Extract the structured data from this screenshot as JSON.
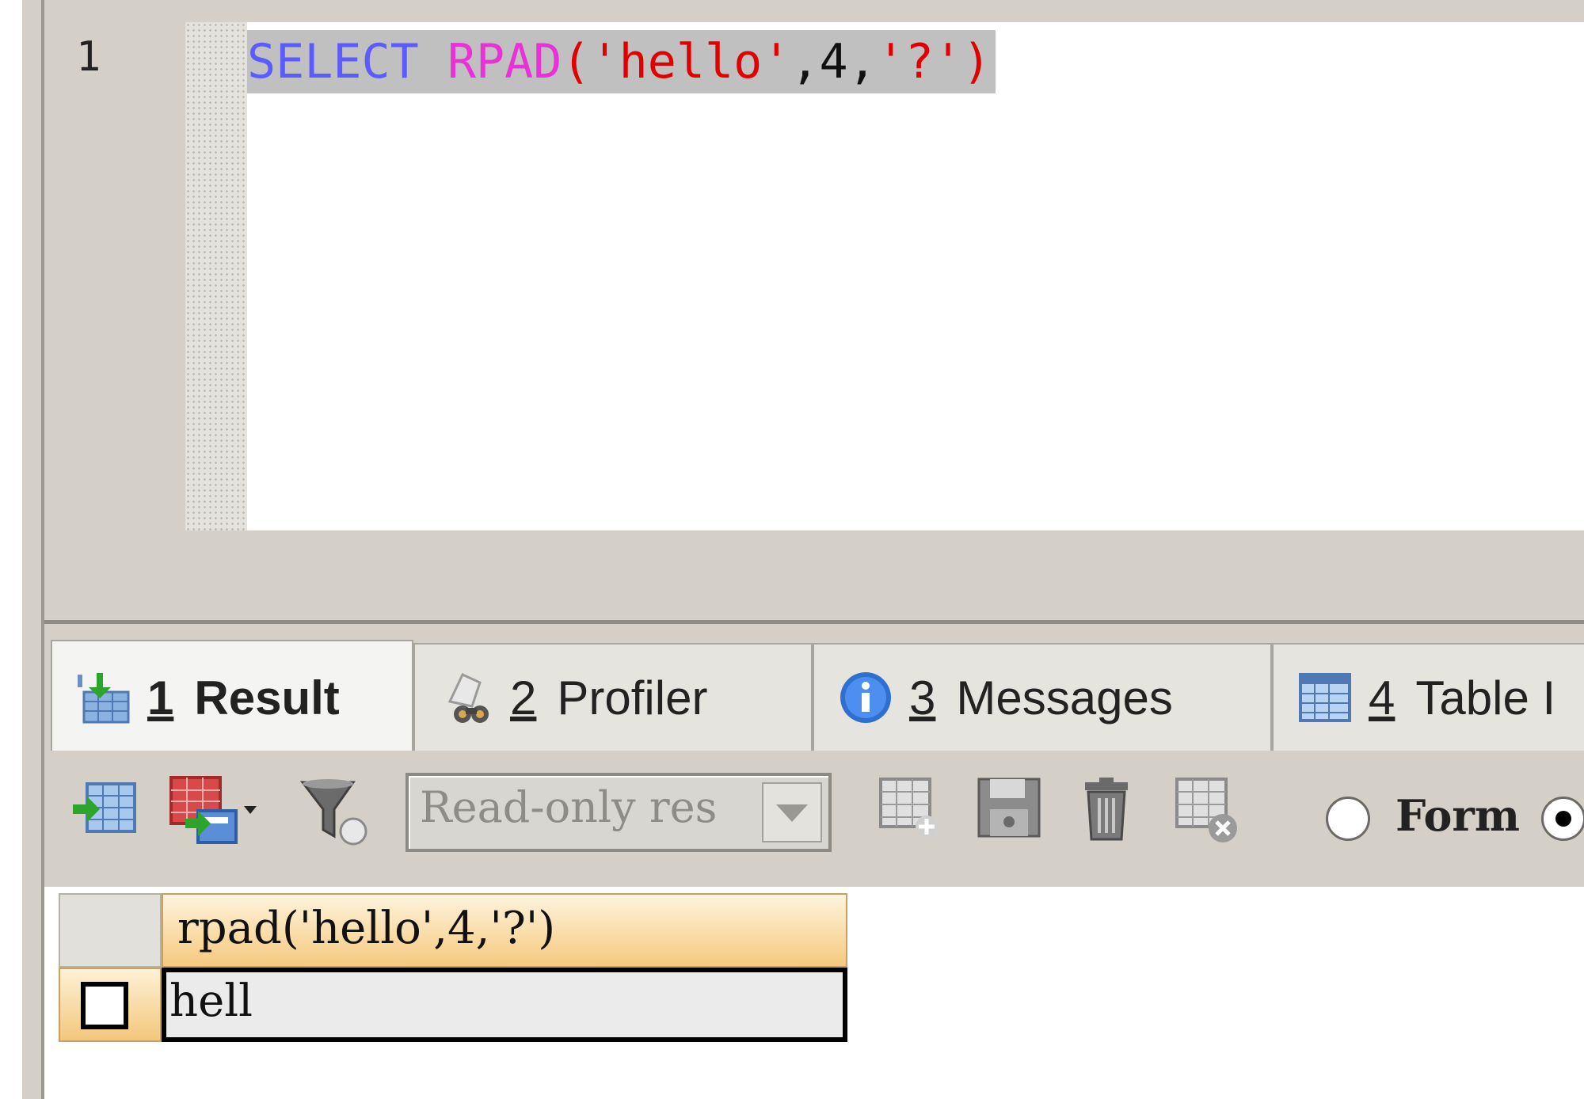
{
  "editor": {
    "line_number": "1",
    "code": {
      "keyword": "SELECT",
      "function": "RPAD",
      "open_paren": "(",
      "arg1": "'hello'",
      "comma1": ",",
      "arg2": "4",
      "comma2": ",",
      "arg3": "'?'",
      "close_paren": ")"
    }
  },
  "tabs": [
    {
      "num": "1",
      "label": "Result",
      "icon": "result-grid-icon",
      "active": true
    },
    {
      "num": "2",
      "label": "Profiler",
      "icon": "profiler-icon",
      "active": false
    },
    {
      "num": "3",
      "label": "Messages",
      "icon": "info-icon",
      "active": false
    },
    {
      "num": "4",
      "label": "Table I",
      "icon": "table-icon",
      "active": false
    }
  ],
  "toolbar": {
    "readonly_select_value": "Read-only res",
    "form_label": "Form"
  },
  "grid": {
    "columns": [
      "rpad('hello',4,'?')"
    ],
    "rows": [
      [
        "hell"
      ]
    ]
  },
  "colors": {
    "keyword": "#5b5bff",
    "function": "#e832d8",
    "string": "#e00000",
    "selection": "#c0c0c0",
    "header_gradient_top": "#fdf4dd",
    "header_gradient_bottom": "#f6c97e"
  }
}
